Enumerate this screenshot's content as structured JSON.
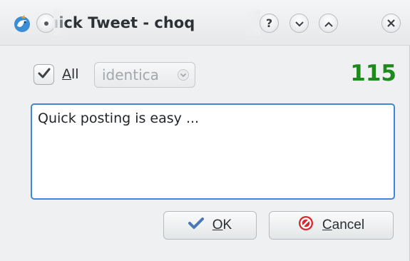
{
  "window": {
    "title": "Quick Tweet - choq",
    "title_visible": "ıick Tweet - choq"
  },
  "titlebar": {
    "app_icon": "bird-icon",
    "menu_button": "dot-icon",
    "help_button": "question-icon",
    "minimize_button": "chevron-down-icon",
    "maximize_button": "chevron-up-icon",
    "close_button": "close-icon"
  },
  "form": {
    "all_checkbox": {
      "label": "All",
      "checked": true
    },
    "account_select": {
      "selected": "identica",
      "enabled": false
    },
    "char_counter": "115",
    "message": "Quick posting is easy ..."
  },
  "buttons": {
    "ok_label": "OK",
    "cancel_label": "Cancel"
  },
  "colors": {
    "counter_green": "#1e8a1e",
    "focus_blue": "#3f86d6",
    "cancel_red": "#d9262f"
  }
}
